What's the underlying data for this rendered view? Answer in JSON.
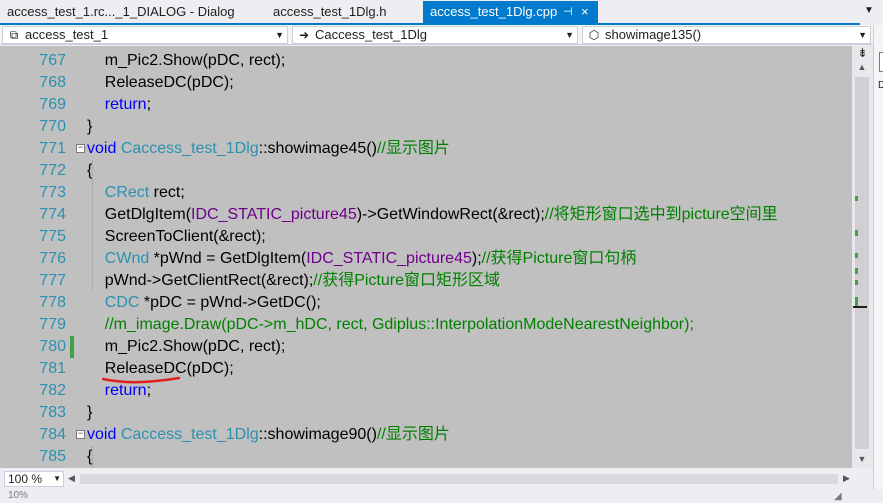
{
  "tabs": [
    {
      "label": "access_test_1.rc..._1_DIALOG - Dialog",
      "active": false
    },
    {
      "label": "access_test_1Dlg.h",
      "active": false
    },
    {
      "label": "access_test_1Dlg.cpp",
      "active": true,
      "pin": "⊣",
      "close": "×"
    }
  ],
  "tab_overflow_icon": "chevron-down-icon",
  "nav": {
    "project": "access_test_1",
    "class": "Caccess_test_1Dlg",
    "member": "showimage135()"
  },
  "lines": [
    {
      "n": "767",
      "tokens": [
        [
          "",
          "    m_Pic2.Show(pDC, rect);"
        ]
      ]
    },
    {
      "n": "768",
      "tokens": [
        [
          "",
          "    ReleaseDC(pDC);"
        ]
      ]
    },
    {
      "n": "769",
      "tokens": [
        [
          "",
          "    "
        ],
        [
          "kw",
          "return"
        ],
        [
          "",
          ";"
        ]
      ]
    },
    {
      "n": "770",
      "tokens": [
        [
          "",
          "}"
        ]
      ]
    },
    {
      "n": "771",
      "fold": "−",
      "tokens": [
        [
          "kw",
          "void"
        ],
        [
          "",
          " "
        ],
        [
          "ty",
          "Caccess_test_1Dlg"
        ],
        [
          "",
          "::showimage45()"
        ],
        [
          "cm",
          "//显示图片"
        ]
      ]
    },
    {
      "n": "772",
      "tokens": [
        [
          "",
          "{"
        ]
      ]
    },
    {
      "n": "773",
      "tokens": [
        [
          "",
          "    "
        ],
        [
          "ty",
          "CRect"
        ],
        [
          "",
          " rect;"
        ]
      ]
    },
    {
      "n": "774",
      "tokens": [
        [
          "",
          "    GetDlgItem("
        ],
        [
          "mac",
          "IDC_STATIC_picture45"
        ],
        [
          "",
          ")->GetWindowRect(&rect);"
        ],
        [
          "cm",
          "//将矩形窗口选中到picture空间里"
        ]
      ]
    },
    {
      "n": "775",
      "tokens": [
        [
          "",
          "    ScreenToClient(&rect);"
        ]
      ]
    },
    {
      "n": "776",
      "tokens": [
        [
          "",
          "    "
        ],
        [
          "ty",
          "CWnd"
        ],
        [
          "",
          " *pWnd = GetDlgItem("
        ],
        [
          "mac",
          "IDC_STATIC_picture45"
        ],
        [
          "",
          ");"
        ],
        [
          "cm",
          "//获得Picture窗口句柄"
        ]
      ]
    },
    {
      "n": "777",
      "tokens": [
        [
          "",
          "    pWnd->GetClientRect(&rect);"
        ],
        [
          "cm",
          "//获得Picture窗口矩形区域"
        ]
      ]
    },
    {
      "n": "778",
      "tokens": [
        [
          "",
          "    "
        ],
        [
          "ty",
          "CDC"
        ],
        [
          "",
          " *pDC = pWnd->GetDC();"
        ]
      ]
    },
    {
      "n": "779",
      "tokens": [
        [
          "",
          "    "
        ],
        [
          "cm",
          "//m_image.Draw(pDC->m_hDC, rect, Gdiplus::InterpolationModeNearestNeighbor);"
        ]
      ]
    },
    {
      "n": "780",
      "changed": true,
      "tokens": [
        [
          "",
          "    m_Pic2.Show(pDC, rect);"
        ]
      ]
    },
    {
      "n": "781",
      "tokens": [
        [
          "",
          "    ReleaseDC(pDC);"
        ]
      ]
    },
    {
      "n": "782",
      "tokens": [
        [
          "",
          "    "
        ],
        [
          "kw",
          "return"
        ],
        [
          "",
          ";"
        ]
      ]
    },
    {
      "n": "783",
      "tokens": [
        [
          "",
          "}"
        ]
      ]
    },
    {
      "n": "784",
      "fold": "−",
      "tokens": [
        [
          "kw",
          "void"
        ],
        [
          "",
          " "
        ],
        [
          "ty",
          "Caccess_test_1Dlg"
        ],
        [
          "",
          "::showimage90()"
        ],
        [
          "cm",
          "//显示图片"
        ]
      ]
    },
    {
      "n": "785",
      "tokens": [
        [
          "",
          "{"
        ]
      ]
    }
  ],
  "zoom": "100 %",
  "status": "10%",
  "colors": {
    "accent": "#007acc",
    "editor_bg": "#c0c0c0",
    "keyword": "#0000ff",
    "type": "#2b91af",
    "comment": "#008000",
    "macro": "#6f008a",
    "change_marker": "#43a047",
    "annotation": "#e02020"
  }
}
